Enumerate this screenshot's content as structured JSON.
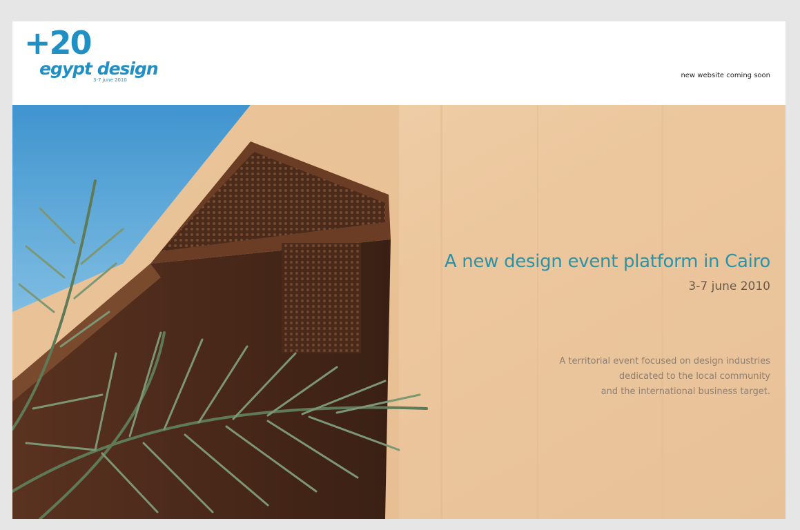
{
  "header": {
    "logo": {
      "number": "+20",
      "name": "egypt design",
      "date": "3-7 june 2010"
    },
    "notice": "new website coming soon"
  },
  "hero": {
    "title": "A new design event platform in Cairo",
    "date": "3-7 june 2010",
    "description": [
      "A territorial event focused on design industries",
      "dedicated to the local community",
      "and the international business target."
    ]
  },
  "colors": {
    "brand": "#1f8fc4",
    "title": "#2b93a8",
    "wall": "#ecc9a0",
    "sky": "#4f9fd0"
  }
}
